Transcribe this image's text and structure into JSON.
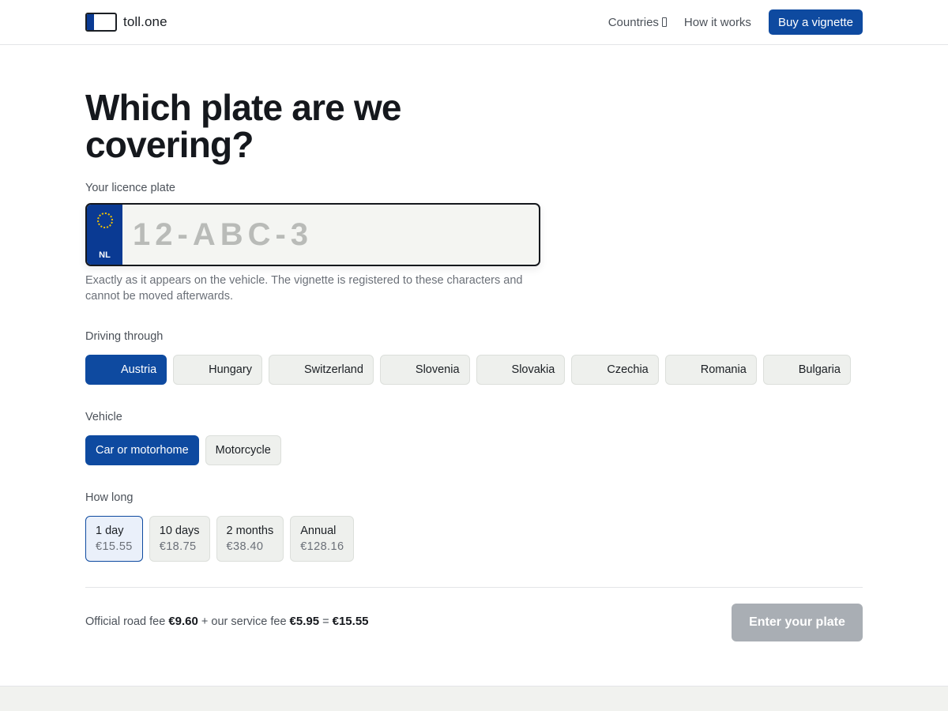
{
  "header": {
    "brand": "toll.one",
    "nav": {
      "countries": "Countries",
      "how_it_works": "How it works",
      "buy": "Buy a vignette"
    }
  },
  "main": {
    "title": "Which plate are we covering?",
    "plate": {
      "label": "Your licence plate",
      "country_code": "NL",
      "placeholder": "12-ABC-3",
      "value": "",
      "help": "Exactly as it appears on the vehicle. The vignette is registered to these characters and cannot be moved afterwards."
    },
    "countries": {
      "label": "Driving through",
      "selected": "Austria",
      "items": [
        "Austria",
        "Hungary",
        "Switzerland",
        "Slovenia",
        "Slovakia",
        "Czechia",
        "Romania",
        "Bulgaria"
      ]
    },
    "vehicle": {
      "label": "Vehicle",
      "selected": "Car or motorhome",
      "items": [
        "Car or motorhome",
        "Motorcycle"
      ]
    },
    "duration": {
      "label": "How long",
      "selected": "1 day",
      "items": [
        {
          "name": "1 day",
          "price": "€15.55"
        },
        {
          "name": "10 days",
          "price": "€18.75"
        },
        {
          "name": "2 months",
          "price": "€38.40"
        },
        {
          "name": "Annual",
          "price": "€128.16"
        }
      ]
    },
    "summary": {
      "official_label": "Official road fee",
      "official_value": "€9.60",
      "service_label": "+ our service fee",
      "service_value": "€5.95",
      "equals": "=",
      "total": "€15.55",
      "cta": "Enter your plate"
    }
  },
  "colors": {
    "accent": "#0e4aa0",
    "plate_band": "#0a3a93",
    "eu_stars": "#f2c200",
    "cta_disabled": "#a9aeb4"
  }
}
